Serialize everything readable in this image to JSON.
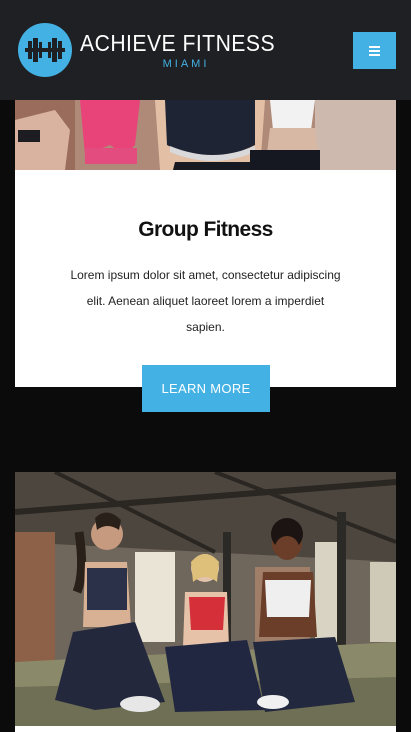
{
  "header": {
    "brand_title": "ACHIEVE FITNESS",
    "brand_subtitle": "MIAMI",
    "logo_icon": "dumbbell-icon",
    "menu_icon": "hamburger-menu-icon",
    "accent_color": "#43b1e3",
    "background_color": "#1f2023"
  },
  "card": {
    "image_alt": "women-in-sportswear-photo",
    "title": "Group Fitness",
    "description": "Lorem ipsum dolor sit amet, consectetur adipiscing elit. Aenean aliquet laoreet lorem a imperdiet sapien.",
    "button_label": "LEARN MORE"
  },
  "card2": {
    "image_alt": "three-women-sitting-in-gym-photo"
  }
}
